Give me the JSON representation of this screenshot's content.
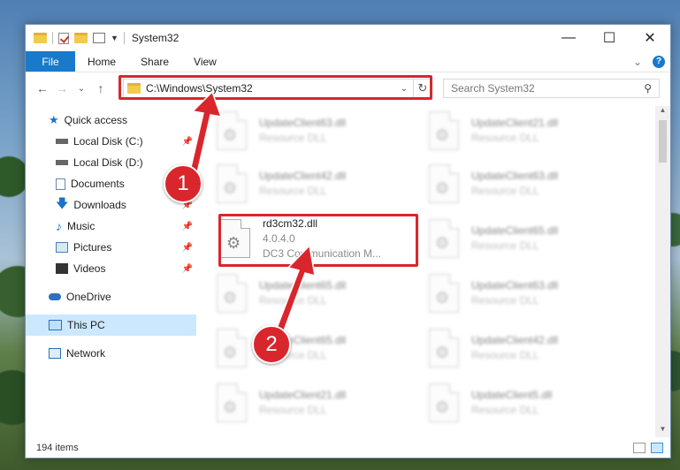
{
  "window": {
    "title": "System32",
    "minimize": "—",
    "maximize": "☐",
    "close": "✕"
  },
  "ribbon": {
    "tabs": [
      "File",
      "Home",
      "Share",
      "View"
    ],
    "expand": "⌄",
    "help": "?"
  },
  "nav": {
    "back": "←",
    "forward": "→",
    "recent": "⌄",
    "up": "↑"
  },
  "address": {
    "path": "C:\\Windows\\System32",
    "dropdown": "⌄",
    "refresh": "↻"
  },
  "search": {
    "placeholder": "Search System32",
    "icon": "⚲"
  },
  "sidebar": {
    "items": [
      {
        "label": "Quick access",
        "icon": "star-icon"
      },
      {
        "label": "Local Disk (C:)",
        "icon": "drive-icon"
      },
      {
        "label": "Local Disk (D:)",
        "icon": "drive-icon"
      },
      {
        "label": "Documents",
        "icon": "document-icon"
      },
      {
        "label": "Downloads",
        "icon": "download-icon"
      },
      {
        "label": "Music",
        "icon": "music-icon"
      },
      {
        "label": "Pictures",
        "icon": "picture-icon"
      },
      {
        "label": "Videos",
        "icon": "video-icon"
      },
      {
        "label": "OneDrive",
        "icon": "cloud-icon"
      },
      {
        "label": "This PC",
        "icon": "computer-icon"
      },
      {
        "label": "Network",
        "icon": "network-icon"
      }
    ]
  },
  "files": {
    "highlighted": {
      "name": "rd3cm32.dll",
      "version": "4.0.4.0",
      "desc": "DC3 Communication M..."
    },
    "blurred": [
      {
        "name": "UpdateClient63.dll",
        "type": "Resource DLL"
      },
      {
        "name": "UpdateClient21.dll",
        "type": "Resource DLL"
      },
      {
        "name": "UpdateClient42.dll",
        "type": "Resource DLL"
      },
      {
        "name": "UpdateClient63.dll",
        "type": "Resource DLL"
      },
      {
        "name": "UpdateClient65.dll",
        "type": "Resource DLL"
      },
      {
        "name": "UpdateClient65.dll",
        "type": "Resource DLL"
      },
      {
        "name": "UpdateClient63.dll",
        "type": "Resource DLL"
      },
      {
        "name": "UpdateClient65.dll",
        "type": "Resource DLL"
      },
      {
        "name": "UpdateClient42.dll",
        "type": "Resource DLL"
      },
      {
        "name": "UpdateClient21.dll",
        "type": "Resource DLL"
      },
      {
        "name": "UpdateClient5.dll",
        "type": "Resource DLL"
      }
    ]
  },
  "status": {
    "count": "194 items"
  },
  "annotations": {
    "step1": "1",
    "step2": "2",
    "color": "#d9262c"
  }
}
